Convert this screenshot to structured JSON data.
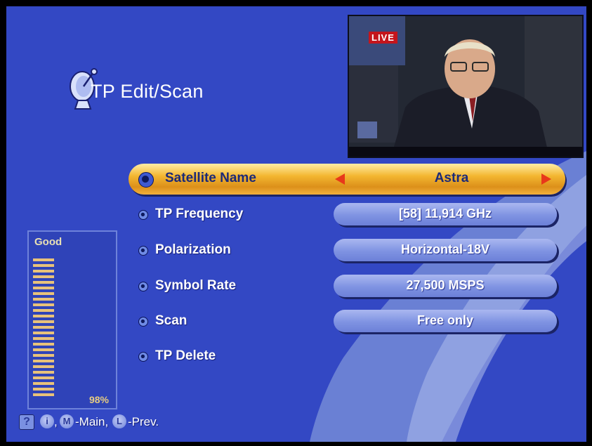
{
  "header": {
    "title": "TP Edit/Scan",
    "icon": "satellite-dish-icon"
  },
  "preview": {
    "live_badge": "LIVE"
  },
  "menu": {
    "satellite_name": {
      "label": "Satellite Name",
      "value": "Astra"
    },
    "tp_frequency": {
      "label": "TP Frequency",
      "value": "[58] 11,914 GHz"
    },
    "polarization": {
      "label": "Polarization",
      "value": "Horizontal-18V"
    },
    "symbol_rate": {
      "label": "Symbol Rate",
      "value": "27,500 MSPS"
    },
    "scan": {
      "label": "Scan",
      "value": "Free only"
    },
    "tp_delete": {
      "label": "TP Delete"
    }
  },
  "signal": {
    "quality_label": "Good",
    "percent_text": "98%",
    "level": 0.98
  },
  "footer": {
    "help_icon": "?",
    "info_key": "i",
    "main_key": "M",
    "main_text": "-Main,",
    "prev_key": "L",
    "prev_text": "-Prev."
  },
  "colors": {
    "background": "#3348c4",
    "highlight": "#f3b630",
    "value_box": "#8a9de6",
    "arrow": "#e8381a",
    "signal_bar": "#e8c27a"
  }
}
